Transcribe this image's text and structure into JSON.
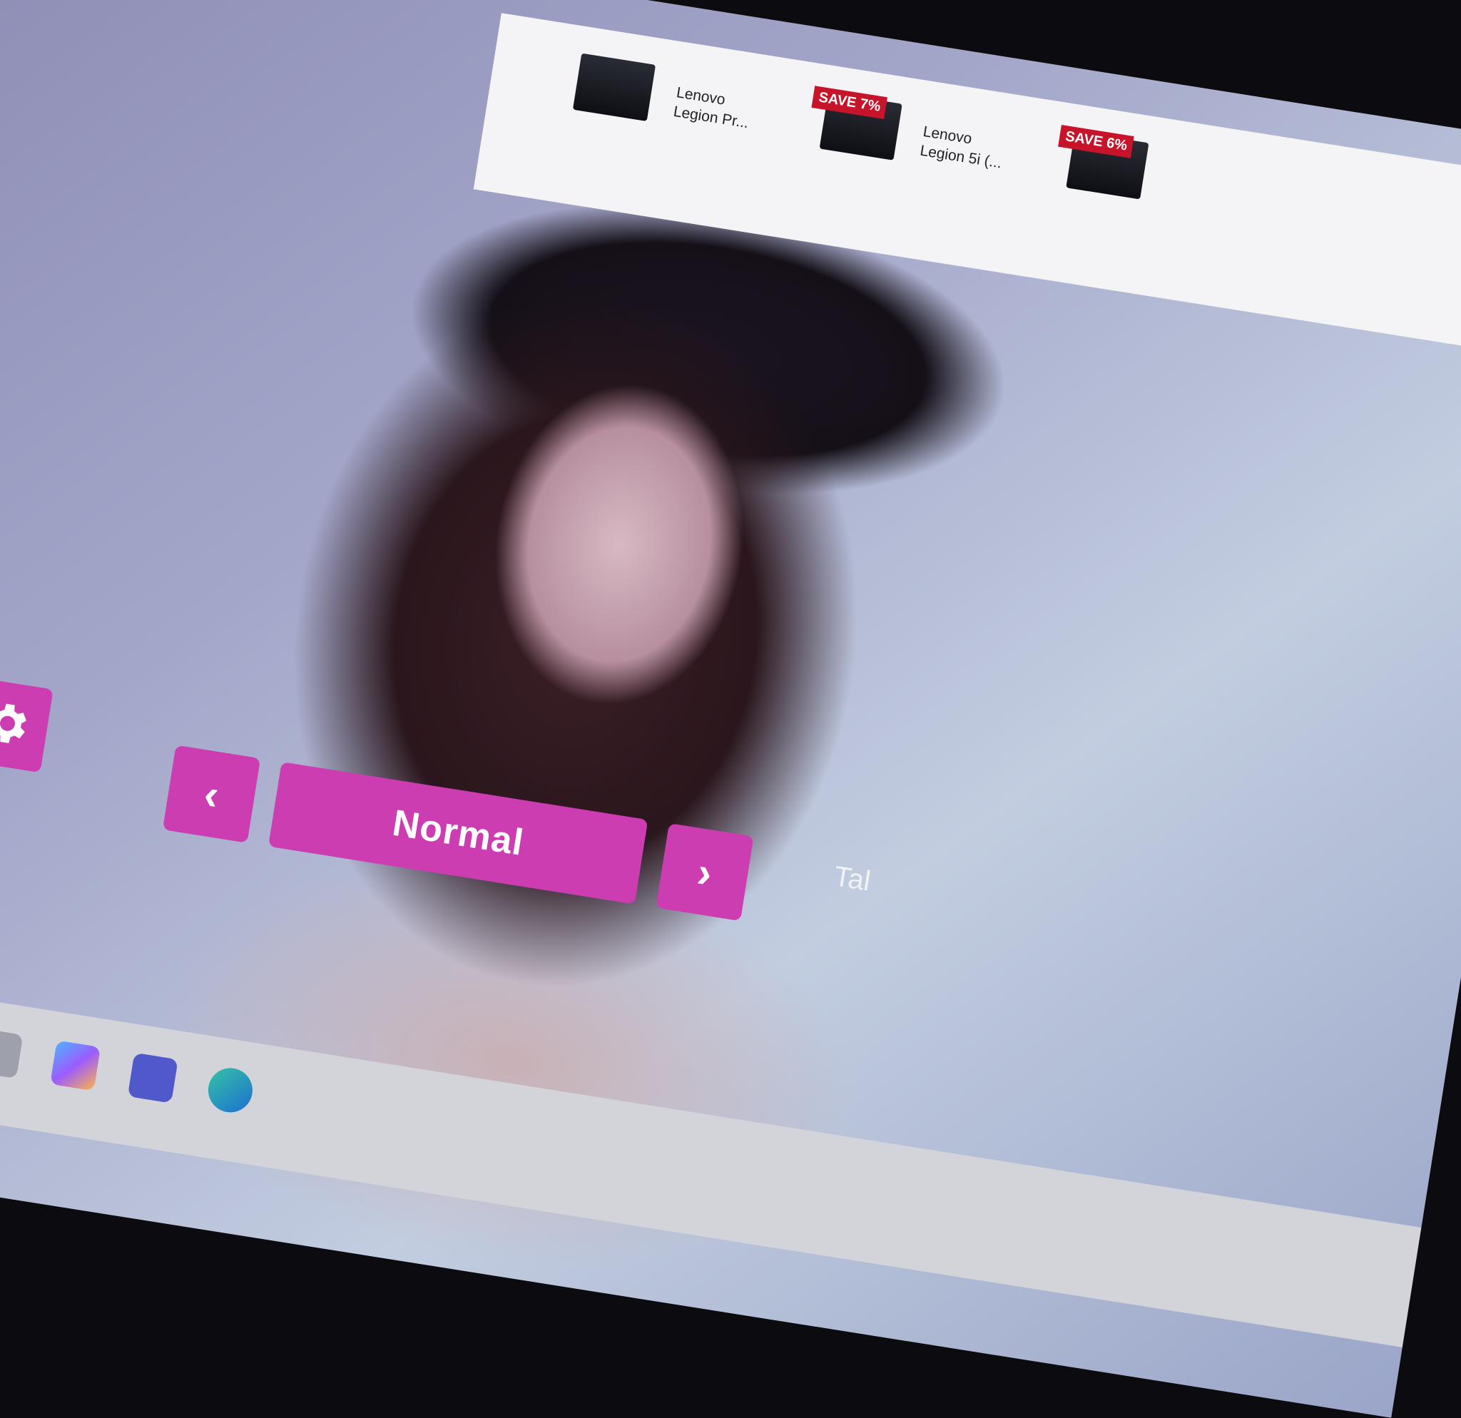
{
  "shop": {
    "products": [
      {
        "title": "Lenovo Legion Pr...",
        "badge": ""
      },
      {
        "title": "Lenovo Legion 5i (...",
        "badge": "SAVE 7%"
      },
      {
        "title": "",
        "badge": "SAVE 6%"
      }
    ]
  },
  "controls": {
    "settings_icon": "gear-icon",
    "prev_icon": "chevron-left-icon",
    "next_icon": "chevron-right-icon",
    "mode_label": "Normal",
    "accent_color": "#cc3db1"
  },
  "bottom_text": "Tal",
  "taskbar": {
    "icons": [
      "widgets-icon",
      "task-view-icon",
      "copilot-icon",
      "teams-icon",
      "edge-icon"
    ]
  },
  "colors": {
    "badge": "#c8142a"
  }
}
